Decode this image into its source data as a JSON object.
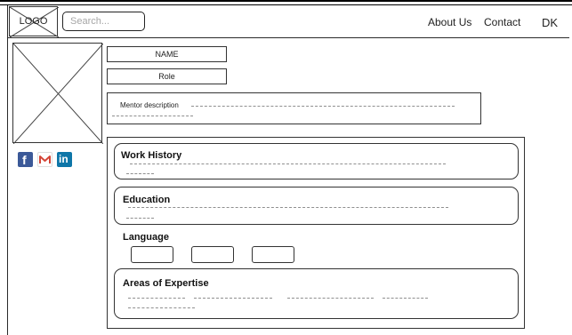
{
  "header": {
    "logo_label": "LOGO",
    "search_placeholder": "Search...",
    "nav": {
      "about": "About Us",
      "contact": "Contact",
      "user_initials": "DK"
    }
  },
  "sidebar": {
    "social_icons": [
      "facebook-icon",
      "gmail-icon",
      "linkedin-icon"
    ],
    "social_colors": {
      "facebook": "#3b5998",
      "gmail": "#d44638",
      "linkedin": "#0e76a8"
    }
  },
  "profile": {
    "name": "NAME",
    "role": "Role",
    "description_label": "Mentor description"
  },
  "sections": {
    "work_history": "Work History",
    "education": "Education",
    "language": "Language",
    "areas_of_expertise": "Areas of Expertise"
  }
}
